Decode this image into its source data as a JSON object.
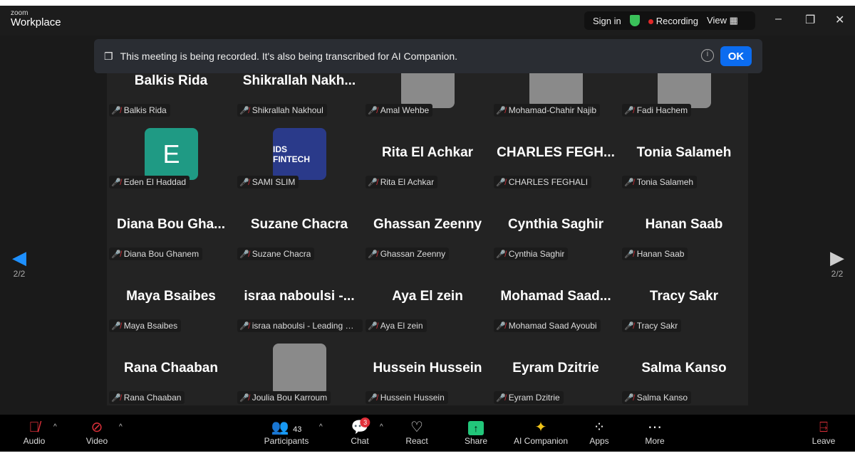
{
  "app": {
    "logo_small": "zoom",
    "logo_main": "Workplace",
    "sign_in": "Sign in",
    "recording": "Recording",
    "view": "View"
  },
  "banner": {
    "text": "This meeting is being recorded. It's also being transcribed for AI Companion.",
    "ok": "OK"
  },
  "pager": {
    "left": "2/2",
    "right": "2/2"
  },
  "tiles": [
    {
      "display": "Balkis Rida",
      "label": "Balkis Rida"
    },
    {
      "display": "Shikrallah  Nakh...",
      "label": "Shikrallah Nakhoul"
    },
    {
      "display": "",
      "label": "Amal Wehbe",
      "photo": true
    },
    {
      "display": "",
      "label": "Mohamad-Chahir Najib",
      "photo": true
    },
    {
      "display": "",
      "label": "Fadi Hachem",
      "photo": true
    },
    {
      "display": "E",
      "label": "Eden El Haddad",
      "avatar": true
    },
    {
      "display": "IDS FINTECH",
      "label": "SAMI SLIM",
      "photo": true
    },
    {
      "display": "Rita El Achkar",
      "label": "Rita El Achkar"
    },
    {
      "display": "CHARLES  FEGH...",
      "label": "CHARLES FEGHALI"
    },
    {
      "display": "Tonia Salameh",
      "label": "Tonia Salameh"
    },
    {
      "display": "Diana  Bou  Gha...",
      "label": "Diana Bou Ghanem"
    },
    {
      "display": "Suzane Chacra",
      "label": "Suzane Chacra"
    },
    {
      "display": "Ghassan Zeenny",
      "label": "Ghassan Zeenny"
    },
    {
      "display": "Cynthia Saghir",
      "label": "Cynthia Saghir"
    },
    {
      "display": "Hanan Saab",
      "label": "Hanan Saab"
    },
    {
      "display": "Maya Bsaibes",
      "label": "Maya Bsaibes"
    },
    {
      "display": "israa  naboulsi  -...",
      "label": "israa naboulsi - Leading Ha..."
    },
    {
      "display": "Aya El zein",
      "label": "Aya El zein"
    },
    {
      "display": "Mohamad  Saad...",
      "label": "Mohamad Saad Ayoubi"
    },
    {
      "display": "Tracy Sakr",
      "label": "Tracy Sakr"
    },
    {
      "display": "Rana Chaaban",
      "label": "Rana Chaaban"
    },
    {
      "display": "",
      "label": "Joulia Bou Karroum",
      "photo": true
    },
    {
      "display": "Hussein Hussein",
      "label": "Hussein Hussein"
    },
    {
      "display": "Eyram Dzitrie",
      "label": "Eyram Dzitrie"
    },
    {
      "display": "Salma Kanso",
      "label": "Salma Kanso"
    }
  ],
  "toolbar": {
    "audio": "Audio",
    "video": "Video",
    "participants": "Participants",
    "participant_count": "43",
    "chat": "Chat",
    "chat_badge": "3",
    "react": "React",
    "share": "Share",
    "ai": "AI Companion",
    "apps": "Apps",
    "more": "More",
    "leave": "Leave"
  },
  "colors": {
    "accent": "#0b6cf0",
    "share": "#22c67a",
    "muted": "#e0303a",
    "recording": "#e02828"
  }
}
